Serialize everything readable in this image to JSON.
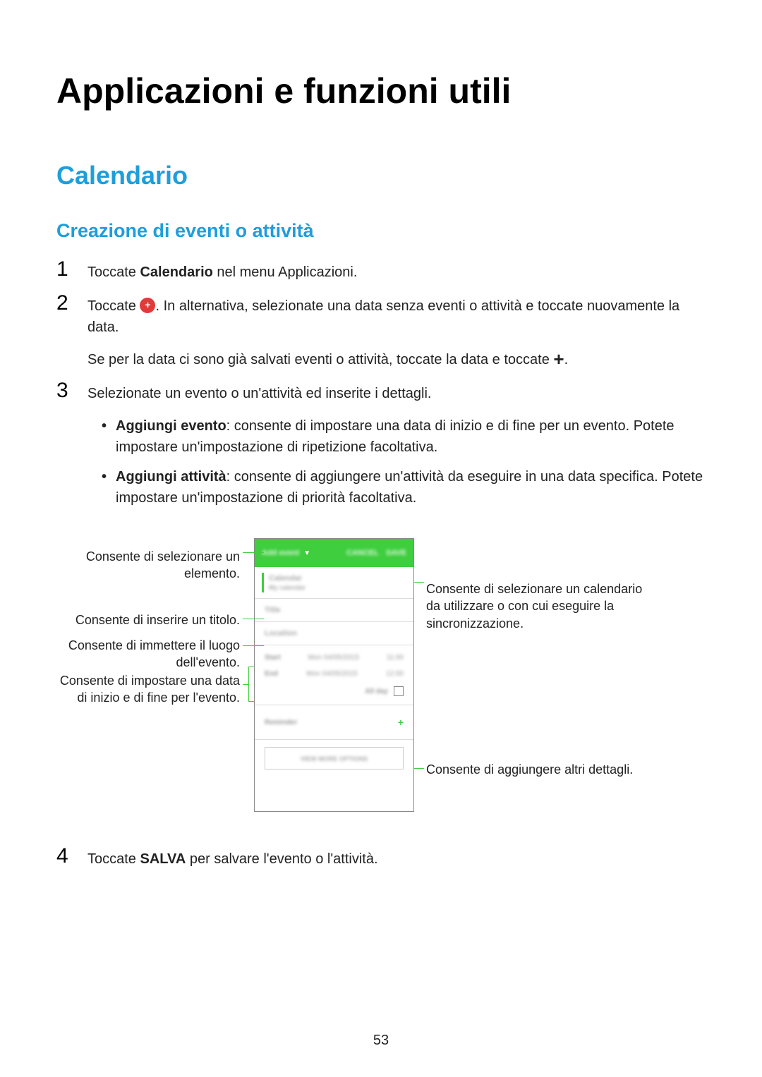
{
  "page_title": "Applicazioni e funzioni utili",
  "section_title": "Calendario",
  "subsection_title": "Creazione di eventi o attività",
  "steps": {
    "s1": {
      "num": "1",
      "text_a": "Toccate ",
      "bold_a": "Calendario",
      "text_b": " nel menu Applicazioni."
    },
    "s2": {
      "num": "2",
      "text_a": "Toccate ",
      "text_b": ". In alternativa, selezionate una data senza eventi o attività e toccate nuovamente la data.",
      "cont_a": "Se per la data ci sono già salvati eventi o attività, toccate la data e toccate ",
      "cont_b": "."
    },
    "s3": {
      "num": "3",
      "text_a": "Selezionate un evento o un'attività ed inserite i dettagli.",
      "bullets": {
        "b1": {
          "bold": "Aggiungi evento",
          "text": ": consente di impostare una data di inizio e di fine per un evento. Potete impostare un'impostazione di ripetizione facoltativa."
        },
        "b2": {
          "bold": "Aggiungi attività",
          "text": ": consente di aggiungere un'attività da eseguire in una data specifica. Potete impostare un'impostazione di priorità facoltativa."
        }
      }
    },
    "s4": {
      "num": "4",
      "text_a": "Toccate ",
      "bold_a": "SALVA",
      "text_b": " per salvare l'evento o l'attività."
    }
  },
  "callouts": {
    "c1": "Consente di selezionare un elemento.",
    "c2": "Consente di inserire un titolo.",
    "c3": "Consente di immettere il luogo dell'evento.",
    "c4": "Consente di impostare una data di inizio e di fine per l'evento.",
    "c5": "Consente di selezionare un calendario da utilizzare o con cui eseguire la sincronizzazione.",
    "c6": "Consente di aggiungere altri dettagli."
  },
  "phone": {
    "header_add": "Add event",
    "header_cancel": "CANCEL",
    "header_save": "SAVE",
    "calendar": "Calendar",
    "my_calendar": "My calendar",
    "title": "Title",
    "location": "Location",
    "start": "Start",
    "start_date": "Mon 04/05/2015",
    "start_time": "11:00",
    "end": "End",
    "end_date": "Mon 04/05/2015",
    "end_time": "12:00",
    "allday": "All day",
    "reminder": "Reminder",
    "view_more": "VIEW MORE OPTIONS"
  },
  "icons": {
    "plus_glyph": "+"
  },
  "page_number": "53"
}
